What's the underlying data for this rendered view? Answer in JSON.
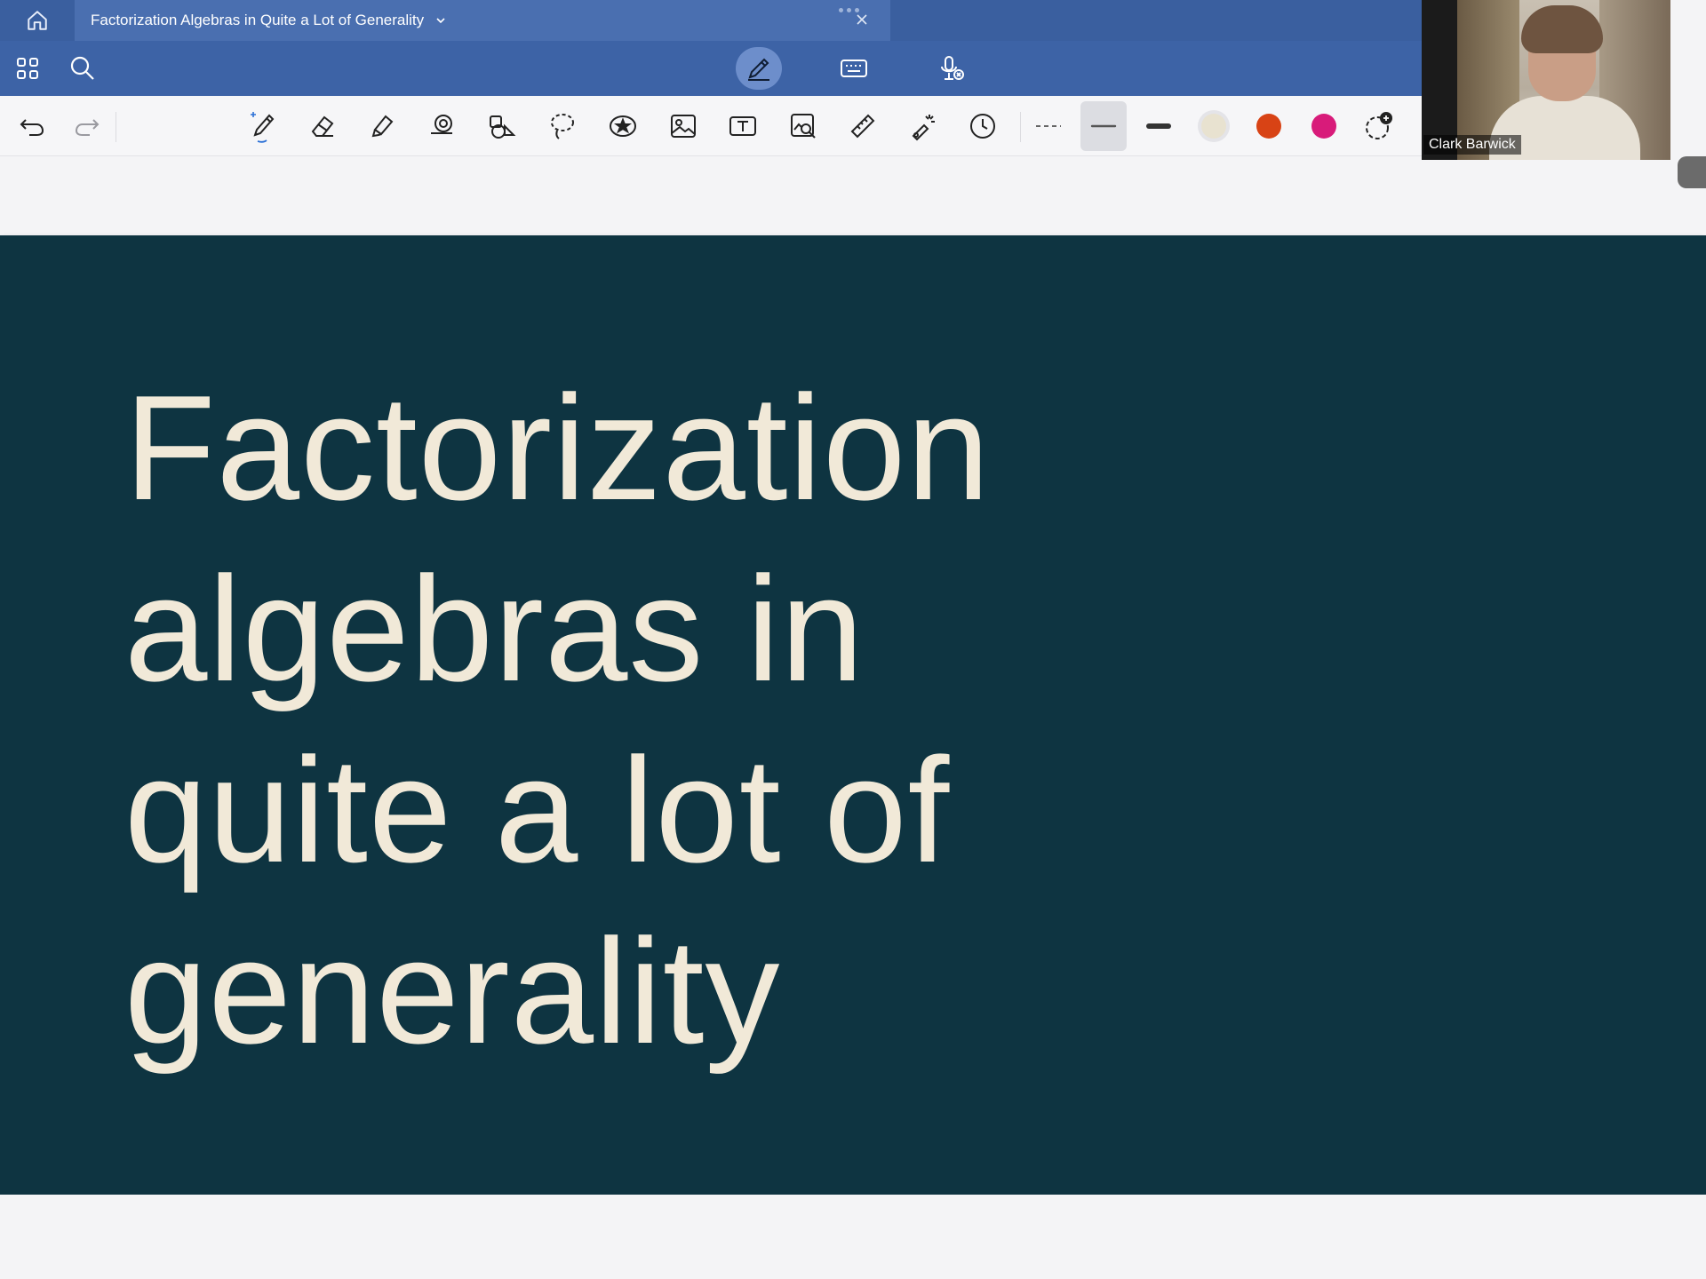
{
  "window": {
    "document_title": "Factorization Algebras in Quite a Lot of Generality"
  },
  "tabbar": {
    "icons": [
      "home-icon",
      "chevron-down-icon",
      "more-dots-icon",
      "close-icon"
    ]
  },
  "modebar": {
    "icons": [
      "grid-icon",
      "search-icon",
      "pen-mode-icon",
      "keyboard-icon",
      "microphone-off-icon"
    ],
    "active_mode": "pen"
  },
  "toolbar": {
    "tools": [
      "undo",
      "redo",
      "pen",
      "eraser",
      "highlighter",
      "shapes",
      "shape-recognition",
      "lasso",
      "sticker",
      "image",
      "text-box",
      "image-search",
      "ruler",
      "laser-pointer",
      "timer"
    ],
    "active_tool": "pen",
    "stroke_widths": [
      "dashed",
      "medium",
      "thick"
    ],
    "selected_stroke": "medium",
    "colors": [
      "#e8e2d0",
      "#d84315",
      "#d81b7a"
    ],
    "selected_color": "#e8e2d0"
  },
  "slide": {
    "background": "#0e3441",
    "text_color": "#f1e9d8",
    "title_lines": [
      "Factorization",
      "algebras in",
      "quite a lot of",
      "generality"
    ]
  },
  "video": {
    "participant_name": "Clark Barwick"
  }
}
